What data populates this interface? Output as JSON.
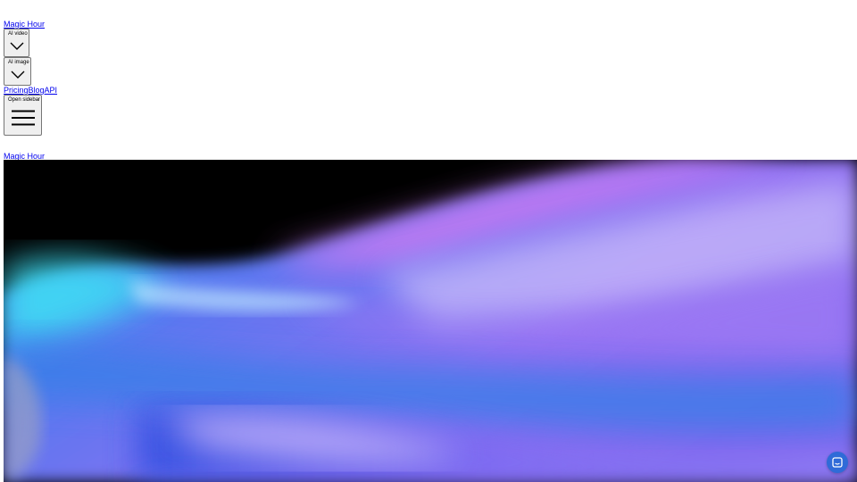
{
  "header": {
    "logo_text": "Magic Hour",
    "menus": [
      {
        "label": "AI video",
        "icon": "chevron-down-icon"
      },
      {
        "label": "AI image",
        "icon": "chevron-down-icon"
      }
    ],
    "links": [
      "Pricing",
      "Blog",
      "API"
    ],
    "sidebar_button": {
      "label": "Open sidebar",
      "icon": "hamburger-menu-icon"
    }
  },
  "main": {
    "logo_text": "Magic Hour",
    "hero_image": "abstract-gradient-waves"
  },
  "chat_widget": {
    "icon": "chat-bubble-icon",
    "color": "#2f6bd8"
  },
  "colors": {
    "link": "#0000ee",
    "hero_purple": "#8a6cf0",
    "hero_cyan": "#35d4f2",
    "hero_pink": "#e06cf0"
  }
}
